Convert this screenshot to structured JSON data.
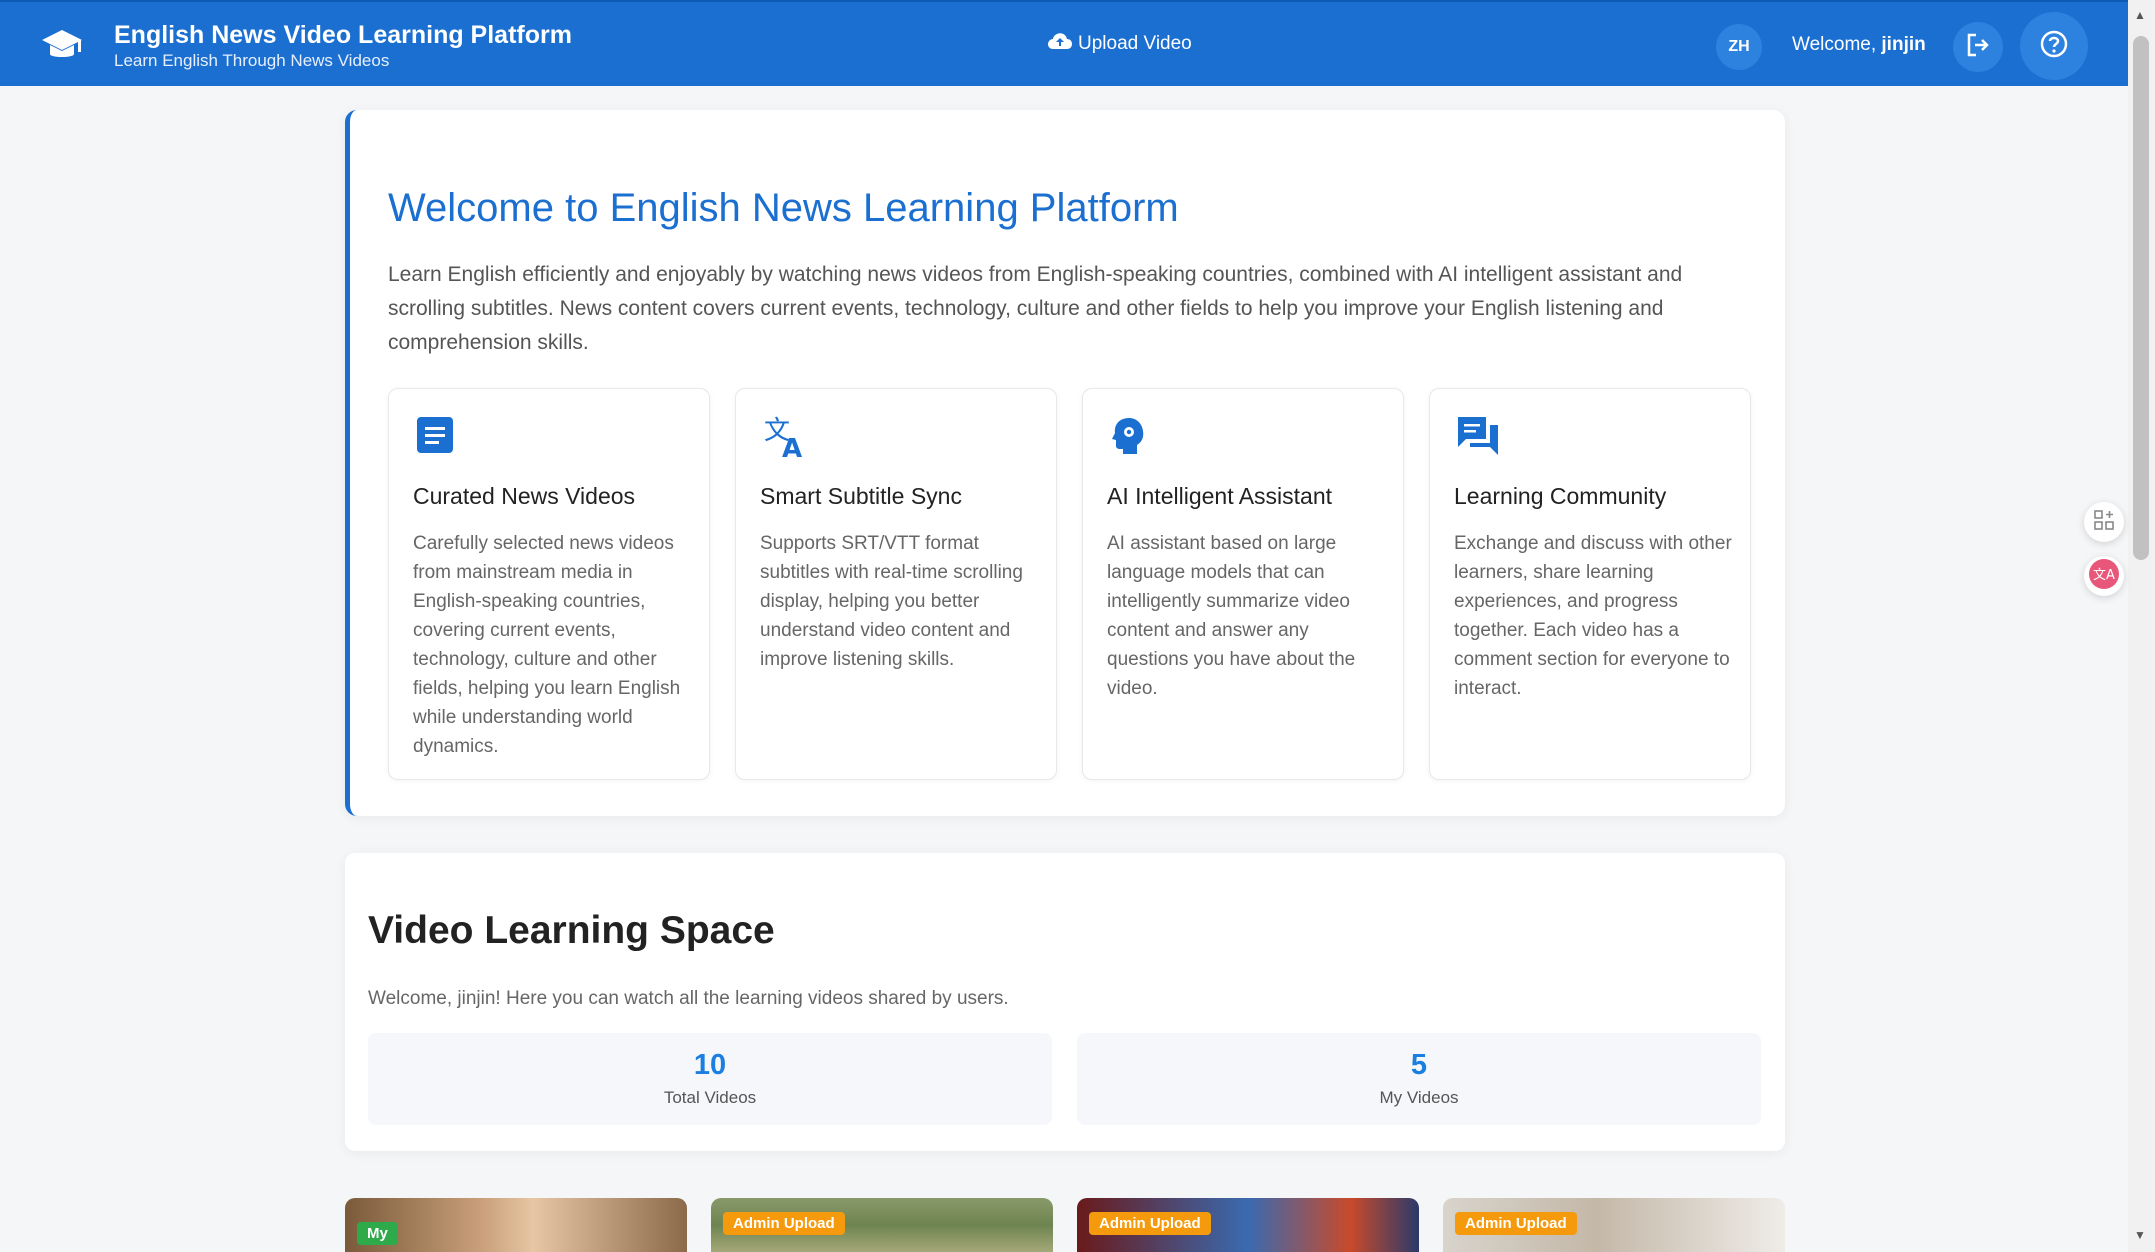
{
  "header": {
    "title": "English News Video Learning Platform",
    "subtitle": "Learn English Through News Videos",
    "upload_label": "Upload Video",
    "lang_badge": "ZH",
    "welcome_prefix": "Welcome, ",
    "username": "jinjin"
  },
  "welcome_card": {
    "title": "Welcome to English News Learning Platform",
    "description": "Learn English efficiently and enjoyably by watching news videos from English-speaking countries, combined with AI intelligent assistant and scrolling subtitles. News content covers current events, technology, culture and other fields to help you improve your English listening and comprehension skills.",
    "features": [
      {
        "icon": "document-icon",
        "title": "Curated News Videos",
        "text": "Carefully selected news videos from mainstream media in English-speaking countries, covering current events, technology, culture and other fields, helping you learn English while understanding world dynamics."
      },
      {
        "icon": "translate-icon",
        "title": "Smart Subtitle Sync",
        "text": "Supports SRT/VTT format subtitles with real-time scrolling display, helping you better understand video content and improve listening skills."
      },
      {
        "icon": "ai-brain-icon",
        "title": "AI Intelligent Assistant",
        "text": "AI assistant based on large language models that can intelligently summarize video content and answer any questions you have about the video."
      },
      {
        "icon": "chat-icon",
        "title": "Learning Community",
        "text": "Exchange and discuss with other learners, share learning experiences, and progress together. Each video has a comment section for everyone to interact."
      }
    ]
  },
  "space": {
    "title": "Video Learning Space",
    "subtitle": "Welcome, jinjin!  Here you can watch all the learning videos shared by users.",
    "stats": [
      {
        "value": "10",
        "label": "Total Videos"
      },
      {
        "value": "5",
        "label": "My Videos"
      }
    ]
  },
  "videos": [
    {
      "badge": "My"
    },
    {
      "badge": "Admin Upload"
    },
    {
      "badge": "Admin Upload"
    },
    {
      "badge": "Admin Upload"
    }
  ],
  "colors": {
    "primary": "#1a6fd0",
    "stat_number": "#1a7fe0",
    "badge_my": "#2eaa4a",
    "badge_admin": "#f59a0c"
  }
}
